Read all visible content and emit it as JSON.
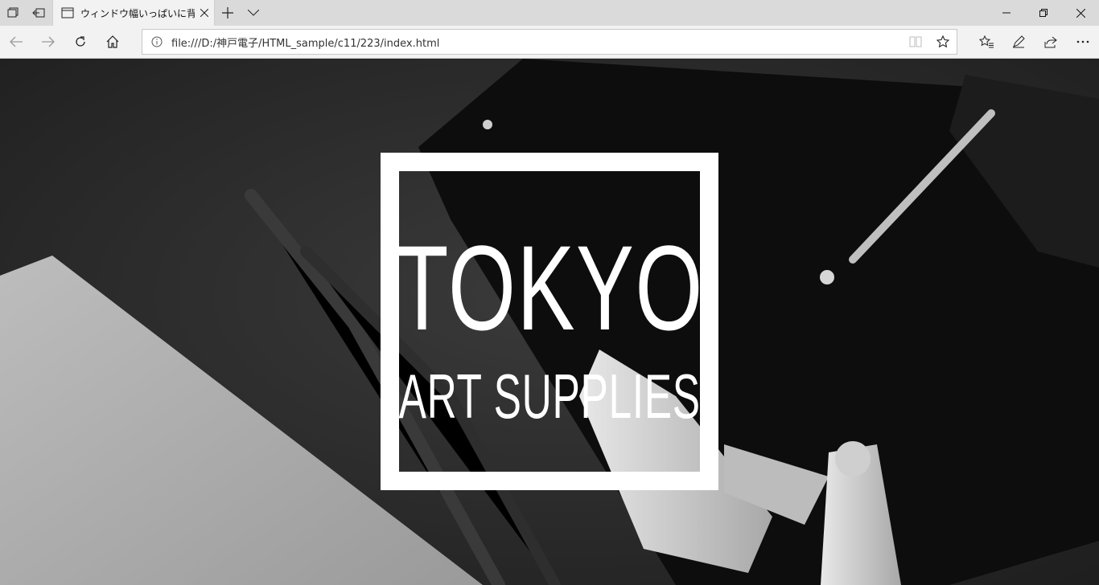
{
  "tabstrip": {
    "tab_title": "ウィンドウ幅いっぱいに背景画",
    "icons": [
      "tabs-aside-icon",
      "restore-tabs-icon",
      "page-icon",
      "close-icon",
      "new-tab-icon",
      "tab-list-icon"
    ]
  },
  "window_controls": [
    "minimize-icon",
    "restore-icon",
    "close-window-icon"
  ],
  "toolbar": {
    "url": "file:///D:/神戸電子/HTML_sample/c11/223/index.html",
    "icons": [
      "back-icon",
      "forward-icon",
      "refresh-icon",
      "home-icon",
      "info-icon",
      "reading-view-icon",
      "favorite-star-icon",
      "favorites-icon",
      "pen-icon",
      "share-icon",
      "more-icon"
    ]
  },
  "page": {
    "logo_title": "TOKYO",
    "logo_subtitle": "ART SUPPLIES",
    "colors": {
      "logo": "#ffffff",
      "tabstrip": "#dadada",
      "toolbar": "#f2f2f2"
    }
  }
}
